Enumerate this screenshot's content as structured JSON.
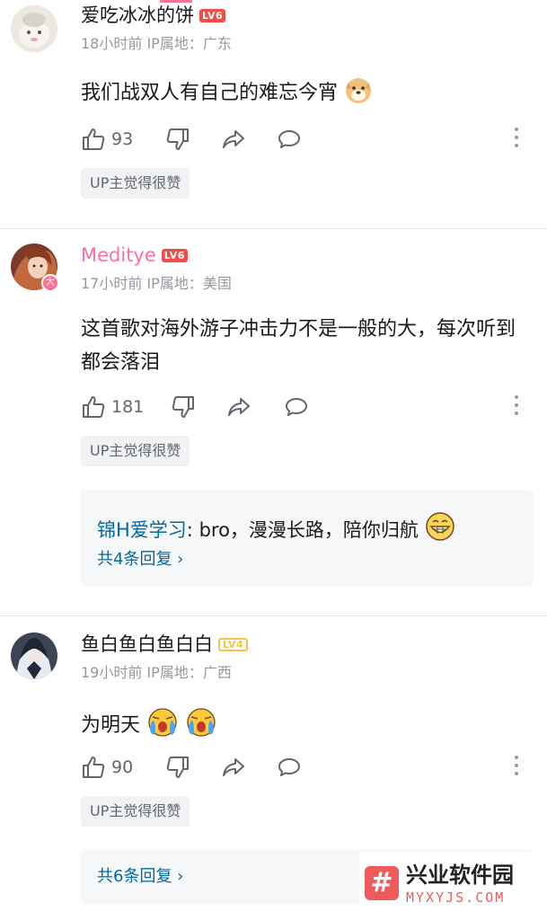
{
  "comments": [
    {
      "username": "爱吃冰冰的饼",
      "level": "LV6",
      "meta": "18小时前 IP属地：广东",
      "content": "我们战双人有自己的难忘今宵",
      "emoji": "doge-emoji",
      "likes": "93",
      "up_liked": "UP主觉得很赞"
    },
    {
      "username": "Meditye",
      "level": "LV6",
      "meta": "17小时前 IP属地：美国",
      "content": "这首歌对海外游子冲击力不是一般的大，每次听到都会落泪",
      "likes": "181",
      "up_liked": "UP主觉得很赞",
      "avatar_badge": "大",
      "reply": {
        "user": "锦H爱学习",
        "separator": ": ",
        "text": "bro，漫漫长路，陪你归航",
        "emoji": "grin-emoji",
        "count": "共4条回复 ›"
      }
    },
    {
      "username": "鱼白鱼白鱼白白",
      "level": "LV4",
      "meta": "19小时前 IP属地：广西",
      "content": "为明天",
      "emoji": "crying-emoji",
      "likes": "90",
      "up_liked": "UP主觉得很赞",
      "reply": {
        "count": "共6条回复 ›"
      }
    }
  ],
  "watermark": {
    "badge": "#",
    "title": "兴业软件园",
    "subtitle": "MYXYJS.COM"
  },
  "colors": {
    "vip_pink": "#fb7299",
    "level_red": "#f04c49",
    "level_yellow": "#f6c343",
    "link_blue": "#00699d",
    "meta_gray": "#9499a0"
  }
}
